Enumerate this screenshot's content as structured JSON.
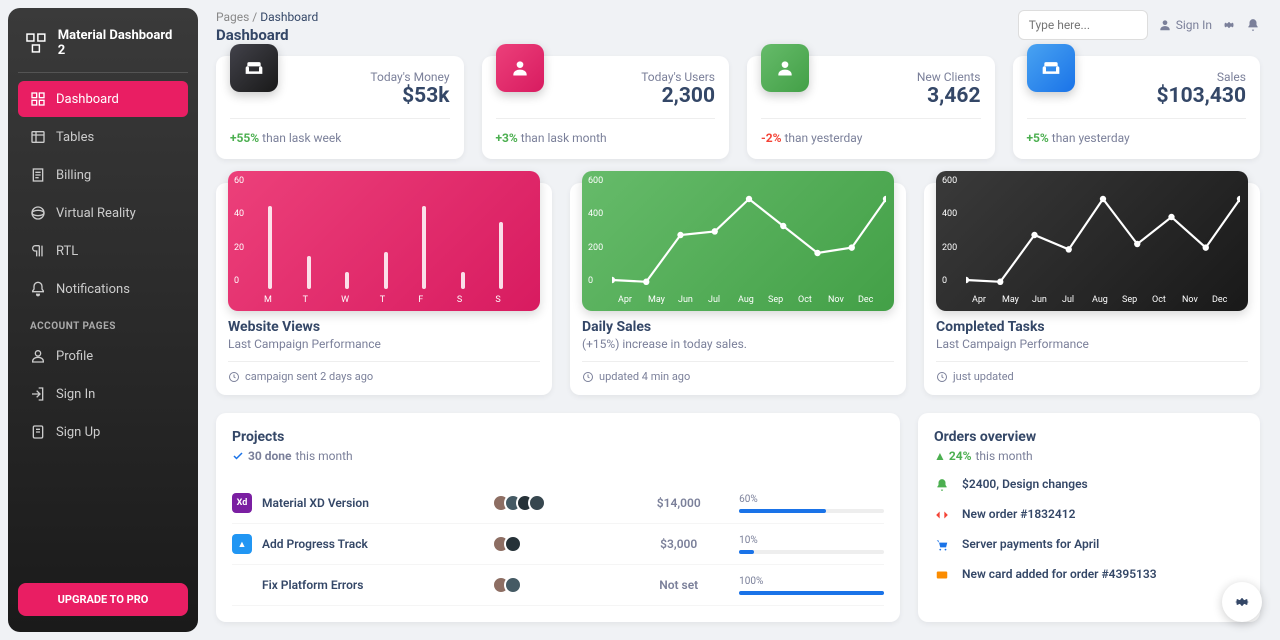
{
  "brand": "Material Dashboard 2",
  "nav": {
    "items": [
      {
        "label": "Dashboard",
        "icon": "dashboard",
        "active": true
      },
      {
        "label": "Tables",
        "icon": "table"
      },
      {
        "label": "Billing",
        "icon": "receipt"
      },
      {
        "label": "Virtual Reality",
        "icon": "vr"
      },
      {
        "label": "RTL",
        "icon": "rtl"
      },
      {
        "label": "Notifications",
        "icon": "bell"
      }
    ],
    "section": "ACCOUNT PAGES",
    "account": [
      {
        "label": "Profile",
        "icon": "user"
      },
      {
        "label": "Sign In",
        "icon": "signin"
      },
      {
        "label": "Sign Up",
        "icon": "signup"
      }
    ],
    "upgrade": "UPGRADE TO PRO"
  },
  "breadcrumb": {
    "root": "Pages",
    "here": "Dashboard"
  },
  "page_title": "Dashboard",
  "search_placeholder": "Type here...",
  "topbar": {
    "signin": "Sign In"
  },
  "stats": [
    {
      "label": "Today's Money",
      "value": "$53k",
      "delta": "+55%",
      "delta_sign": "pos",
      "note": " than lask week",
      "icon": "weekend",
      "color": "ic-dark"
    },
    {
      "label": "Today's Users",
      "value": "2,300",
      "delta": "+3%",
      "delta_sign": "pos",
      "note": " than lask month",
      "icon": "person",
      "color": "ic-pink"
    },
    {
      "label": "New Clients",
      "value": "3,462",
      "delta": "-2%",
      "delta_sign": "neg",
      "note": " than yesterday",
      "icon": "person",
      "color": "ic-green"
    },
    {
      "label": "Sales",
      "value": "$103,430",
      "delta": "+5%",
      "delta_sign": "pos",
      "note": " than yesterday",
      "icon": "weekend",
      "color": "ic-blue"
    }
  ],
  "chart_data": [
    {
      "type": "bar",
      "title": "Website Views",
      "subtitle": "Last Campaign Performance",
      "meta": "campaign sent 2 days ago",
      "color": "cb-pink",
      "categories": [
        "M",
        "T",
        "W",
        "T",
        "F",
        "S",
        "S"
      ],
      "values": [
        50,
        20,
        10,
        22,
        50,
        10,
        40
      ],
      "ylim": [
        0,
        60
      ],
      "yticks": [
        0,
        20,
        40,
        60
      ]
    },
    {
      "type": "line",
      "title": "Daily Sales",
      "subtitle": "(+15%) increase in today sales.",
      "meta": "updated 4 min ago",
      "color": "cb-green",
      "categories": [
        "Apr",
        "May",
        "Jun",
        "Jul",
        "Aug",
        "Sep",
        "Oct",
        "Nov",
        "Dec"
      ],
      "values": [
        50,
        40,
        300,
        320,
        500,
        350,
        200,
        230,
        500
      ],
      "ylim": [
        0,
        600
      ],
      "yticks": [
        0,
        200,
        400,
        600
      ]
    },
    {
      "type": "line",
      "title": "Completed Tasks",
      "subtitle": "Last Campaign Performance",
      "meta": "just updated",
      "color": "cb-dark",
      "categories": [
        "Apr",
        "May",
        "Jun",
        "Jul",
        "Aug",
        "Sep",
        "Oct",
        "Nov",
        "Dec"
      ],
      "values": [
        50,
        40,
        300,
        220,
        500,
        250,
        400,
        230,
        500
      ],
      "ylim": [
        0,
        600
      ],
      "yticks": [
        0,
        200,
        400,
        600
      ]
    }
  ],
  "projects": {
    "title": "Projects",
    "done_count": "30 done",
    "done_suffix": " this month",
    "rows": [
      {
        "name": "Material XD Version",
        "budget": "$14,000",
        "completion": 60,
        "icon_bg": "#7b1fa2",
        "icon_text": "Xd",
        "avatars": [
          "#8d6e63",
          "#455a64",
          "#263238",
          "#37474f"
        ]
      },
      {
        "name": "Add Progress Track",
        "budget": "$3,000",
        "completion": 10,
        "icon_bg": "#2196f3",
        "icon_text": "▲",
        "avatars": [
          "#8d6e63",
          "#263238"
        ]
      },
      {
        "name": "Fix Platform Errors",
        "budget": "Not set",
        "completion": 100,
        "icon_bg": "#fff",
        "icon_text": "⁂",
        "avatars": [
          "#8d6e63",
          "#455a64"
        ]
      }
    ]
  },
  "orders": {
    "title": "Orders overview",
    "delta": "24%",
    "delta_suffix": " this month",
    "items": [
      {
        "text": "$2400, Design changes",
        "icon": "bell",
        "color": "#4caf50"
      },
      {
        "text": "New order #1832412",
        "icon": "code",
        "color": "#f44336"
      },
      {
        "text": "Server payments for April",
        "icon": "cart",
        "color": "#1a73e8"
      },
      {
        "text": "New card added for order #4395133",
        "icon": "card",
        "color": "#fb8c00"
      }
    ]
  }
}
